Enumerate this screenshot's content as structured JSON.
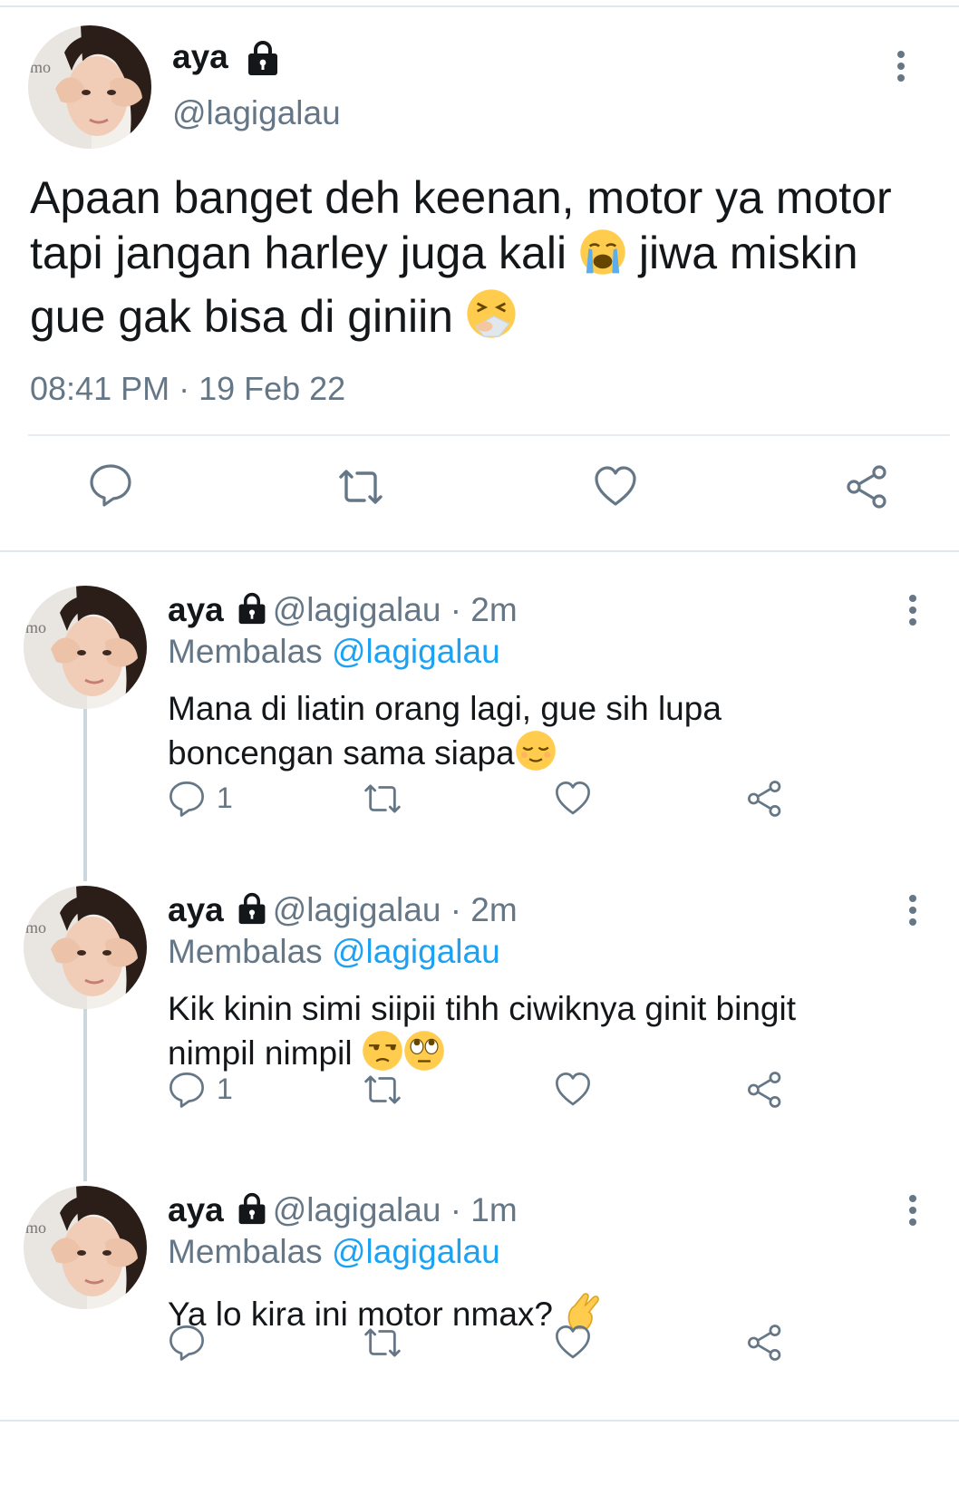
{
  "main_tweet": {
    "name": "aya",
    "handle": "@lagigalau",
    "text_line1": "Apaan banget deh keenan, motor ya motor",
    "text_line2a": "tapi jangan harley juga kali",
    "text_line2b": "jiwa miskin",
    "text_line3": "gue gak bisa di giniin",
    "timestamp": "08:41 PM · 19 Feb 22",
    "emojis": [
      "loudly-crying-face-emoji",
      "sneezing-face-emoji"
    ]
  },
  "replies": [
    {
      "name": "aya",
      "handle": "@lagigalau",
      "time": "· 2m",
      "replying_prefix": "Membalas",
      "replying_to": "@lagigalau",
      "text_line1": "Mana di liatin orang lagi, gue sih lupa",
      "text_line2": "boncengan sama siapa",
      "reply_count": "1",
      "emojis": [
        "relieved-face-emoji"
      ]
    },
    {
      "name": "aya",
      "handle": "@lagigalau",
      "time": "· 2m",
      "replying_prefix": "Membalas",
      "replying_to": "@lagigalau",
      "text_line1": "Kik kinin simi siipii tihh ciwiknya ginit bingit",
      "text_line2": "nimpil nimpil",
      "reply_count": "1",
      "emojis": [
        "unamused-face-emoji",
        "eye-roll-emoji"
      ]
    },
    {
      "name": "aya",
      "handle": "@lagigalau",
      "time": "· 1m",
      "replying_prefix": "Membalas",
      "replying_to": "@lagigalau",
      "text_line1": "Ya lo kira ini motor nmax?",
      "text_line2": "",
      "reply_count": "",
      "emojis": [
        "pinching-hand-emoji"
      ]
    }
  ],
  "colors": {
    "primary_text": "#14171a",
    "secondary_text": "#657786",
    "mention": "#1da1f2",
    "divider": "#e1e8ed"
  }
}
